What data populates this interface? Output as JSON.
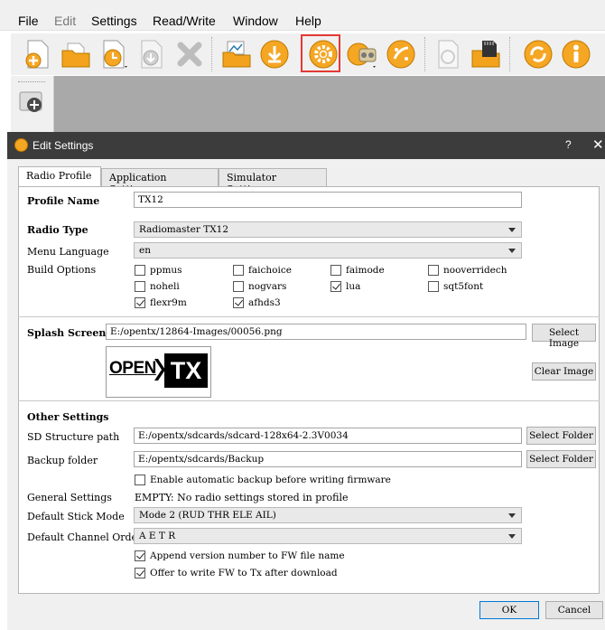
{
  "menu": {
    "file": "File",
    "edit": "Edit",
    "settings": "Settings",
    "read_write": "Read/Write",
    "window": "Window",
    "help": "Help"
  },
  "toolbar": {
    "icons": [
      "new-file-icon",
      "open-folder-icon",
      "recent-clock-icon",
      "save-disc-icon",
      "delete-x-icon",
      "open-model-icon",
      "download-icon",
      "settings-gear-icon",
      "radio-settings-icon",
      "palette-icon",
      "compare-icon",
      "sd-card-icon",
      "sync-icon",
      "info-icon"
    ]
  },
  "colors": {
    "highlight": "#e53935",
    "dialog_title_bg": "#3c3c3c",
    "toolbar_orange": "#f5a623"
  },
  "dialog": {
    "title": "Edit Settings",
    "help": "?",
    "close": "✕",
    "tabs": [
      "Radio Profile",
      "Application Settings",
      "Simulator Settings"
    ],
    "profile_name_label": "Profile Name",
    "profile_name_value": "TX12",
    "radio_type_label": "Radio Type",
    "radio_type_value": "Radiomaster TX12",
    "menu_language_label": "Menu Language",
    "menu_language_value": "en",
    "build_options_label": "Build Options",
    "build_options": [
      {
        "label": "ppmus",
        "checked": false
      },
      {
        "label": "faichoice",
        "checked": false
      },
      {
        "label": "faimode",
        "checked": false
      },
      {
        "label": "nooverridech",
        "checked": false
      },
      {
        "label": "noheli",
        "checked": false
      },
      {
        "label": "nogvars",
        "checked": false
      },
      {
        "label": "lua",
        "checked": true
      },
      {
        "label": "sqt5font",
        "checked": false
      },
      {
        "label": "flexr9m",
        "checked": true
      },
      {
        "label": "afhds3",
        "checked": true
      }
    ],
    "splash_label": "Splash Screen",
    "splash_path": "E:/opentx/12864-Images/00056.png",
    "splash_logo_left": "OPEN",
    "splash_logo_right": "TX",
    "select_image": "Select Image",
    "clear_image": "Clear Image",
    "other_settings": "Other Settings",
    "sd_path_label": "SD Structure path",
    "sd_path_value": "E:/opentx/sdcards/sdcard-128x64-2.3V0034",
    "select_folder": "Select Folder",
    "backup_label": "Backup folder",
    "backup_value": "E:/opentx/sdcards/Backup",
    "auto_backup": "Enable automatic backup before writing firmware",
    "general_label": "General Settings",
    "general_value": "EMPTY: No radio settings stored in profile",
    "stick_mode_label": "Default Stick Mode",
    "stick_mode_value": "Mode 2 (RUD THR ELE AIL)",
    "channel_order_label": "Default Channel Order",
    "channel_order_value": "A E T R",
    "append_version": "Append version number to FW file name",
    "offer_write": "Offer to write FW to Tx after download",
    "ok": "OK",
    "cancel": "Cancel"
  }
}
